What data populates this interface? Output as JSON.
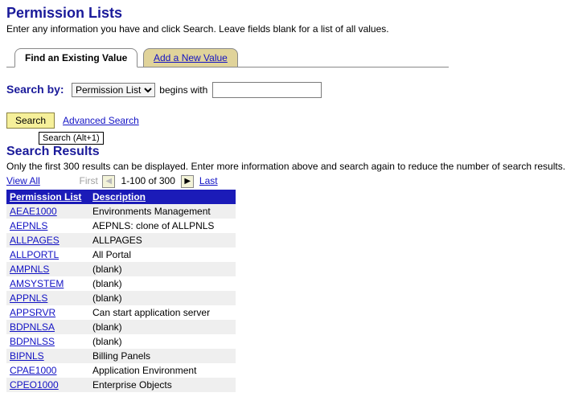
{
  "page": {
    "title": "Permission Lists",
    "instruction": "Enter any information you have and click Search. Leave fields blank for a list of all values."
  },
  "tabs": {
    "active": "Find an Existing Value",
    "inactive": "Add a New Value"
  },
  "search": {
    "label": "Search by:",
    "field_option": "Permission List",
    "operator": "begins with",
    "value": "",
    "button": "Search",
    "advanced": "Advanced Search",
    "tooltip": "Search (Alt+1)"
  },
  "results": {
    "title": "Search Results",
    "note": "Only the first 300 results can be displayed. Enter more information above and search again to reduce the number of search results.",
    "view_all": "View All",
    "first": "First",
    "range": "1-100 of 300",
    "last": "Last",
    "columns": {
      "c0": "Permission List",
      "c1": "Description"
    },
    "rows": [
      {
        "perm": "AEAE1000",
        "desc": "Environments Management"
      },
      {
        "perm": "AEPNLS",
        "desc": "AEPNLS: clone of ALLPNLS"
      },
      {
        "perm": "ALLPAGES",
        "desc": "ALLPAGES"
      },
      {
        "perm": "ALLPORTL",
        "desc": "All Portal"
      },
      {
        "perm": "AMPNLS",
        "desc": "(blank)"
      },
      {
        "perm": "AMSYSTEM",
        "desc": "(blank)"
      },
      {
        "perm": "APPNLS",
        "desc": "(blank)"
      },
      {
        "perm": "APPSRVR",
        "desc": "Can start application server"
      },
      {
        "perm": "BDPNLSA",
        "desc": "(blank)"
      },
      {
        "perm": "BDPNLSS",
        "desc": "(blank)"
      },
      {
        "perm": "BIPNLS",
        "desc": "Billing Panels"
      },
      {
        "perm": "CPAE1000",
        "desc": "Application Environment"
      },
      {
        "perm": "CPEO1000",
        "desc": "Enterprise Objects"
      }
    ]
  }
}
